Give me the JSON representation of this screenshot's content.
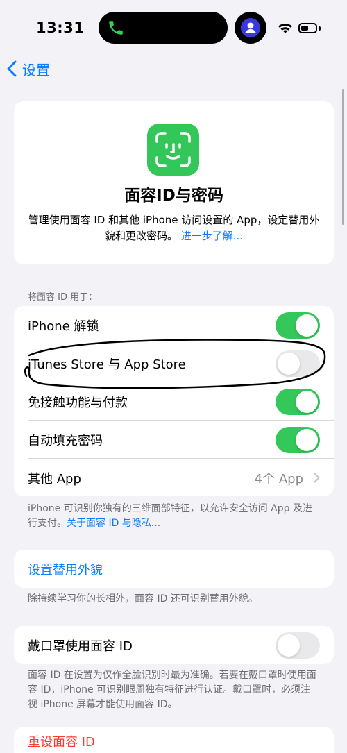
{
  "status": {
    "time": "13:31"
  },
  "nav": {
    "back_label": "设置"
  },
  "hero": {
    "title": "面容ID与密码",
    "description": "管理使用面容 ID 和其他 iPhone 访问设置的 App，设定替用外貌和更改密码。",
    "link": "进一步了解..."
  },
  "use_section": {
    "header": "将面容 ID 用于：",
    "rows": [
      {
        "label": "iPhone 解锁",
        "on": true
      },
      {
        "label": "iTunes Store 与 App Store",
        "on": false
      },
      {
        "label": "免接触功能与付款",
        "on": true
      },
      {
        "label": "自动填充密码",
        "on": true
      },
      {
        "label": "其他 App",
        "value": "4个 App"
      }
    ],
    "footnote": "iPhone 可识别你独有的三维面部特征，以允许安全访问 App 及进行支付。",
    "footnote_link": "关于面容 ID 与隐私..."
  },
  "alt_appearance": {
    "label": "设置替用外貌",
    "footnote": "除持续学习你的长相外，面容 ID 还可识别替用外貌。"
  },
  "mask": {
    "label": "戴口罩使用面容 ID",
    "on": false,
    "footnote": "面容 ID 在设置为仅作全脸识别时最为准确。若要在戴口罩时使用面容 ID，iPhone 可识别眼周独有特征进行认证。戴口罩时，必须注视 iPhone 屏幕才能使用面容 ID。"
  },
  "reset": {
    "label": "重设面容 ID"
  },
  "colors": {
    "green": "#34c759",
    "blue": "#0a7cff",
    "red": "#ff3b30"
  }
}
